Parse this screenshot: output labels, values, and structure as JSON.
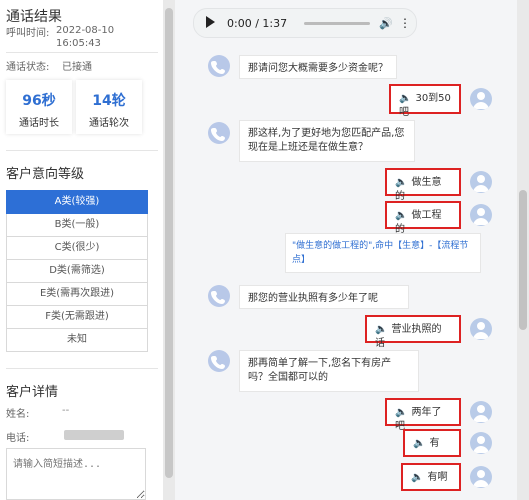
{
  "left": {
    "title": "通话结果",
    "call_time_label": "呼叫时间:",
    "call_time_value": "2022-08-10 16:05:43",
    "status_label": "通话状态:",
    "status_value": "已接通",
    "stats": [
      {
        "value": "96秒",
        "label": "通话时长"
      },
      {
        "value": "14轮",
        "label": "通话轮次"
      }
    ],
    "intent_title": "客户意向等级",
    "levels": [
      "A类(较强)",
      "B类(一般)",
      "C类(很少)",
      "D类(需筛选)",
      "E类(需再次跟进)",
      "F类(无需跟进)",
      "未知"
    ],
    "detail_title": "客户详情",
    "name_label": "姓名:",
    "name_value": "--",
    "phone_label": "电话:",
    "desc_placeholder": "请输入简短描述..."
  },
  "audio": {
    "time": "0:00 / 1:37",
    "progress": 0
  },
  "chat": {
    "q1": "那请问您大概需要多少资金呢？",
    "a1": "30到50吧",
    "q2": "那这样,为了更好地为您匹配产品,您现在是上班还是在做生意？",
    "a2": "做生意的",
    "a3": "做工程的",
    "tag": "\"做生意的做工程的\",命中【生意】-【流程节点】",
    "q3": "那您的营业执照有多少年了呢",
    "a4": "营业执照的话",
    "q4": "那再简单了解一下,您名下有房产吗？全国都可以的",
    "a5": "两年了吧",
    "a6": "有",
    "a7": "有啊"
  },
  "colors": {
    "accent": "#2d6fd6",
    "highlight": "#d22222"
  }
}
